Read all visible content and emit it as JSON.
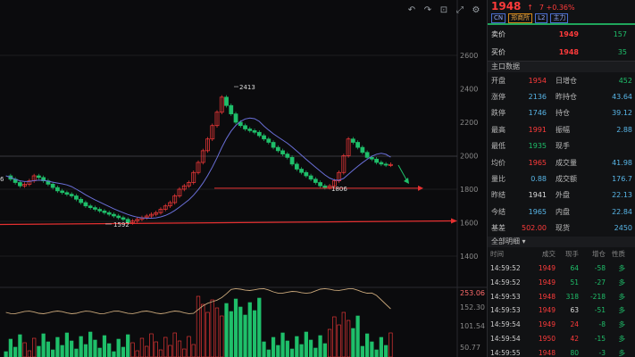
{
  "quote": {
    "price": "1948",
    "change_arrow": "↑",
    "change": "7 +0.36%",
    "tags": [
      "CN",
      "郑商所",
      "L2",
      "主力"
    ]
  },
  "bidask": [
    {
      "label": "卖价",
      "price": "1949",
      "volume": "157"
    },
    {
      "label": "买价",
      "price": "1948",
      "volume": "35"
    }
  ],
  "section_main_title": "主口数据",
  "stats": [
    {
      "l1": "开盘",
      "v1": "1954",
      "c1": "red",
      "l2": "日增仓",
      "v2": "452",
      "c2": "green"
    },
    {
      "l1": "涨停",
      "v1": "2136",
      "c1": "cyan",
      "l2": "昨持仓",
      "v2": "43.64",
      "c2": "cyan"
    },
    {
      "l1": "跌停",
      "v1": "1746",
      "c1": "cyan",
      "l2": "持仓",
      "v2": "39.12",
      "c2": "cyan"
    },
    {
      "l1": "最高",
      "v1": "1991",
      "c1": "red",
      "l2": "振幅",
      "v2": "2.88",
      "c2": "cyan"
    },
    {
      "l1": "最低",
      "v1": "1935",
      "c1": "green",
      "l2": "现手",
      "v2": "",
      "c2": "white"
    },
    {
      "l1": "均价",
      "v1": "1965",
      "c1": "red",
      "l2": "成交量",
      "v2": "41.98",
      "c2": "cyan"
    },
    {
      "l1": "量比",
      "v1": "0.88",
      "c1": "cyan",
      "l2": "成交额",
      "v2": "176.7",
      "c2": "cyan"
    },
    {
      "l1": "昨结",
      "v1": "1941",
      "c1": "white",
      "l2": "外盘",
      "v2": "22.13",
      "c2": "cyan"
    },
    {
      "l1": "今结",
      "v1": "1965",
      "c1": "cyan",
      "l2": "内盘",
      "v2": "22.84",
      "c2": "cyan"
    },
    {
      "l1": "基差",
      "v1": "502.00",
      "c1": "red",
      "l2": "现货",
      "v2": "2450",
      "c2": "cyan"
    }
  ],
  "section_trades_title": "全部明细",
  "trade_headers": [
    "时间",
    "成交",
    "现手",
    "增仓",
    "性质"
  ],
  "trades": [
    {
      "time": "14:59:52",
      "price": "1949",
      "pc": "red",
      "qty": "64",
      "qc": "green",
      "oi": "-58",
      "oc": "green",
      "nature": "多"
    },
    {
      "time": "14:59:52",
      "price": "1949",
      "pc": "red",
      "qty": "51",
      "qc": "green",
      "oi": "-27",
      "oc": "green",
      "nature": "多"
    },
    {
      "time": "14:59:53",
      "price": "1948",
      "pc": "red",
      "qty": "318",
      "qc": "green",
      "oi": "-218",
      "oc": "green",
      "nature": "多"
    },
    {
      "time": "14:59:53",
      "price": "1949",
      "pc": "red",
      "qty": "63",
      "qc": "white",
      "oi": "-51",
      "oc": "green",
      "nature": "多"
    },
    {
      "time": "14:59:54",
      "price": "1949",
      "pc": "red",
      "qty": "24",
      "qc": "red",
      "oi": "-8",
      "oc": "green",
      "nature": "多"
    },
    {
      "time": "14:59:54",
      "price": "1950",
      "pc": "red",
      "qty": "42",
      "qc": "red",
      "oi": "-15",
      "oc": "green",
      "nature": "多"
    },
    {
      "time": "14:59:55",
      "price": "1948",
      "pc": "red",
      "qty": "80",
      "qc": "green",
      "oi": "-3",
      "oc": "green",
      "nature": "多"
    }
  ],
  "chart": {
    "price_axis": [
      "2600",
      "2400",
      "2200",
      "2000",
      "1800",
      "1600",
      "1400"
    ],
    "volume_axis": [
      "253.06",
      "152.30",
      "101.54",
      "50.77"
    ],
    "high_label": "2413",
    "low_label": "1592",
    "support_label": "1806",
    "left_edge_label": "6",
    "toolbar_icons": [
      "↶",
      "↷",
      "⊡",
      "⤢",
      "⚙"
    ]
  },
  "colors": {
    "up": "#ff3b3b",
    "down": "#1fbf6a",
    "ma": "#6a6fd8",
    "volume_line": "#c9a77a",
    "arrow": "#e53030"
  }
}
